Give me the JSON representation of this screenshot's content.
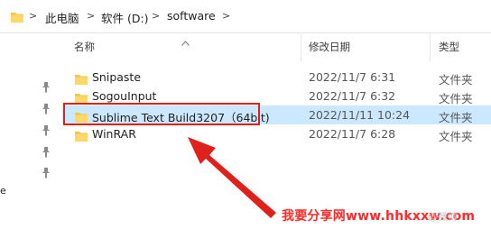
{
  "breadcrumb": {
    "items": [
      "此电脑",
      "软件 (D:)",
      "software"
    ],
    "separator": ">"
  },
  "columns": {
    "name": "名称",
    "date": "修改日期",
    "type": "类型"
  },
  "files": [
    {
      "name": "Snipaste",
      "date": "2022/11/7 6:31",
      "type": "文件夹",
      "selected": false
    },
    {
      "name": "SogouInput",
      "date": "2022/11/7 6:32",
      "type": "文件夹",
      "selected": false
    },
    {
      "name": "Sublime Text Build3207（64bit)",
      "date": "2022/11/11 10:24",
      "type": "文件夹",
      "selected": true
    },
    {
      "name": "WinRAR",
      "date": "2022/11/7 6:28",
      "type": "文件夹",
      "selected": false
    }
  ],
  "nav_fragment": "e",
  "watermark": {
    "text": "我要分享网www.hhkxxw.com",
    "faint": "@微博"
  },
  "colors": {
    "highlight": "#e0201b",
    "selection": "#cce8ff",
    "folder": "#f4c542",
    "watermark": "#ff2a2a"
  },
  "icons": [
    "folder-icon",
    "pin-icon",
    "sort-up-icon",
    "arrow-annotation"
  ]
}
